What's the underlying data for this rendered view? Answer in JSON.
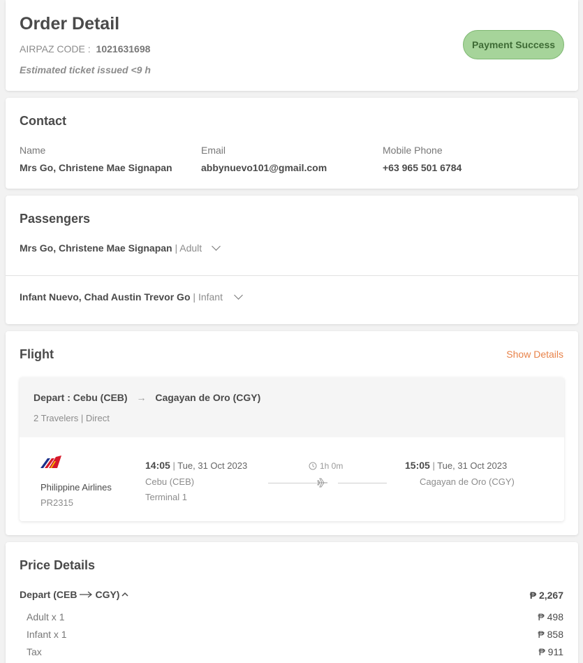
{
  "order": {
    "title": "Order Detail",
    "code_label": "AIRPAZ CODE :",
    "code_value": "1021631698",
    "estimate": "Estimated ticket issued <9 h",
    "status": "Payment Success"
  },
  "contact": {
    "title": "Contact",
    "name_label": "Name",
    "name_value": "Mrs Go, Christene Mae Signapan",
    "email_label": "Email",
    "email_value": "abbynuevo101@gmail.com",
    "phone_label": "Mobile Phone",
    "phone_value": "+63 965 501 6784"
  },
  "passengers": {
    "title": "Passengers",
    "items": [
      {
        "name": "Mrs Go, Christene Mae Signapan",
        "sep": "|",
        "type": "Adult"
      },
      {
        "name": "Infant Nuevo, Chad Austin Trevor Go",
        "sep": "|",
        "type": "Infant"
      }
    ]
  },
  "flight": {
    "title": "Flight",
    "show_details": "Show Details",
    "route_from": "Depart : Cebu (CEB)",
    "route_to": "Cagayan de Oro (CGY)",
    "summary": "2 Travelers | Direct",
    "airline": "Philippine Airlines",
    "flight_no": "PR2315",
    "dep_time": "14:05",
    "dep_date": "Tue, 31 Oct 2023",
    "dep_airport": "Cebu (CEB)",
    "dep_terminal": "Terminal 1",
    "duration": "1h 0m",
    "arr_time": "15:05",
    "arr_date": "Tue, 31 Oct 2023",
    "arr_airport": "Cagayan de Oro (CGY)",
    "sep": "|"
  },
  "price": {
    "title": "Price Details",
    "depart_label_a": "Depart (CEB",
    "depart_label_b": "CGY)",
    "depart_total": "₱ 2,267",
    "rows": [
      {
        "label": "Adult x 1",
        "amount": "₱ 498"
      },
      {
        "label": "Infant x 1",
        "amount": "₱ 858"
      },
      {
        "label": "Tax",
        "amount": "₱ 911"
      }
    ]
  },
  "colors": {
    "accent": "#e8834a",
    "badge_bg": "#a6d49a",
    "badge_text": "#3e6b35"
  },
  "icons": [
    "chevron-down-icon",
    "arrow-right-icon",
    "clock-icon",
    "plane-icon",
    "airline-logo-icon",
    "chevron-up-icon"
  ]
}
